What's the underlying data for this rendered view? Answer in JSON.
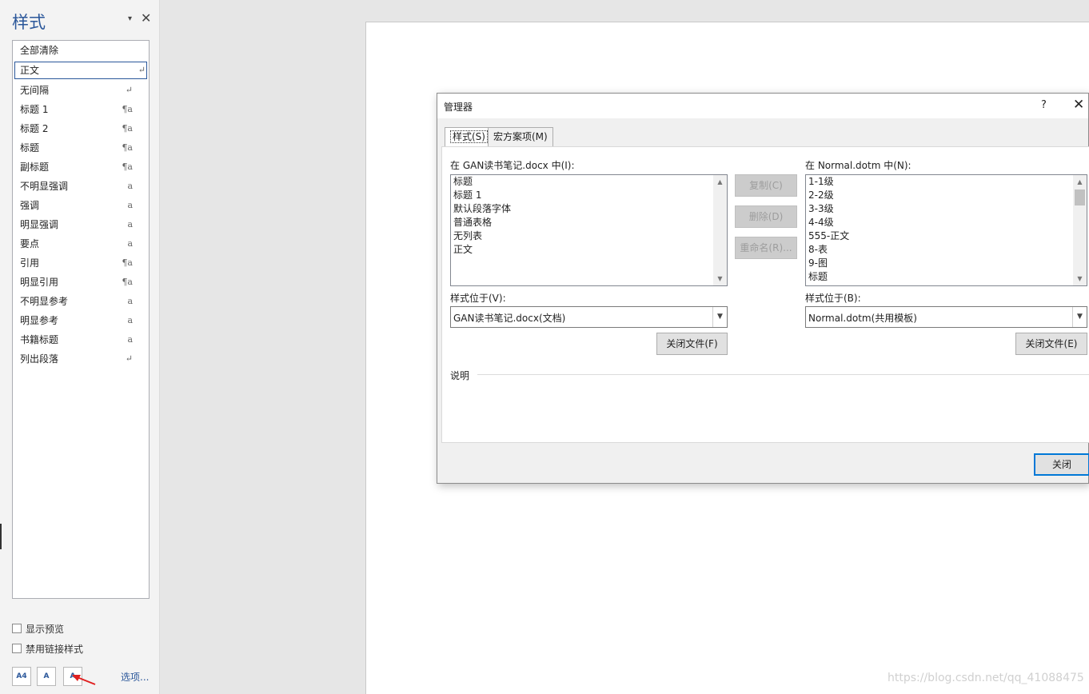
{
  "styles_pane": {
    "title": "样式",
    "dropdown_glyph": "▾",
    "close_glyph": "✕",
    "items": [
      {
        "label": "全部清除",
        "mark": ""
      },
      {
        "label": "正文",
        "mark": "↵"
      },
      {
        "label": "无间隔",
        "mark": "↵"
      },
      {
        "label": "标题 1",
        "mark": "¶a"
      },
      {
        "label": "标题 2",
        "mark": "¶a"
      },
      {
        "label": "标题",
        "mark": "¶a"
      },
      {
        "label": "副标题",
        "mark": "¶a"
      },
      {
        "label": "不明显强调",
        "mark": "a"
      },
      {
        "label": "强调",
        "mark": "a"
      },
      {
        "label": "明显强调",
        "mark": "a"
      },
      {
        "label": "要点",
        "mark": "a"
      },
      {
        "label": "引用",
        "mark": "¶a"
      },
      {
        "label": "明显引用",
        "mark": "¶a"
      },
      {
        "label": "不明显参考",
        "mark": "a"
      },
      {
        "label": "明显参考",
        "mark": "a"
      },
      {
        "label": "书籍标题",
        "mark": "a"
      },
      {
        "label": "列出段落",
        "mark": "↵"
      }
    ],
    "show_preview": "显示预览",
    "disable_linked": "禁用链接样式",
    "new_style_icon": "A4",
    "inspector_icon": "A",
    "manage_icon": "A",
    "options": "选项..."
  },
  "dialog": {
    "title": "管理器",
    "help": "?",
    "close": "✕",
    "tabs": [
      {
        "label": "样式(S)"
      },
      {
        "label": "宏方案项(M)"
      }
    ],
    "left_label": "在 GAN读书笔记.docx 中(I):",
    "left_items": [
      "标题",
      "标题 1",
      "默认段落字体",
      "普通表格",
      "无列表",
      "正文"
    ],
    "right_label": "在 Normal.dotm 中(N):",
    "right_items": [
      "1-1级",
      "2-2级",
      "3-3级",
      "4-4级",
      "555-正文",
      "8-表",
      "9-图",
      "标题"
    ],
    "copy_btn": "复制(C)",
    "delete_btn": "删除(D)",
    "rename_btn": "重命名(R)...",
    "left_loc_label": "样式位于(V):",
    "left_loc_value": "GAN读书笔记.docx(文档)",
    "right_loc_label": "样式位于(B):",
    "right_loc_value": "Normal.dotm(共用模板)",
    "close_file_left": "关闭文件(F)",
    "close_file_right": "关闭文件(E)",
    "description_label": "说明",
    "close_btn": "关闭"
  },
  "watermark": "https://blog.csdn.net/qq_41088475",
  "colors": {
    "accent": "#2b579a",
    "focus": "#0078d7",
    "arrow": "#e02020"
  }
}
